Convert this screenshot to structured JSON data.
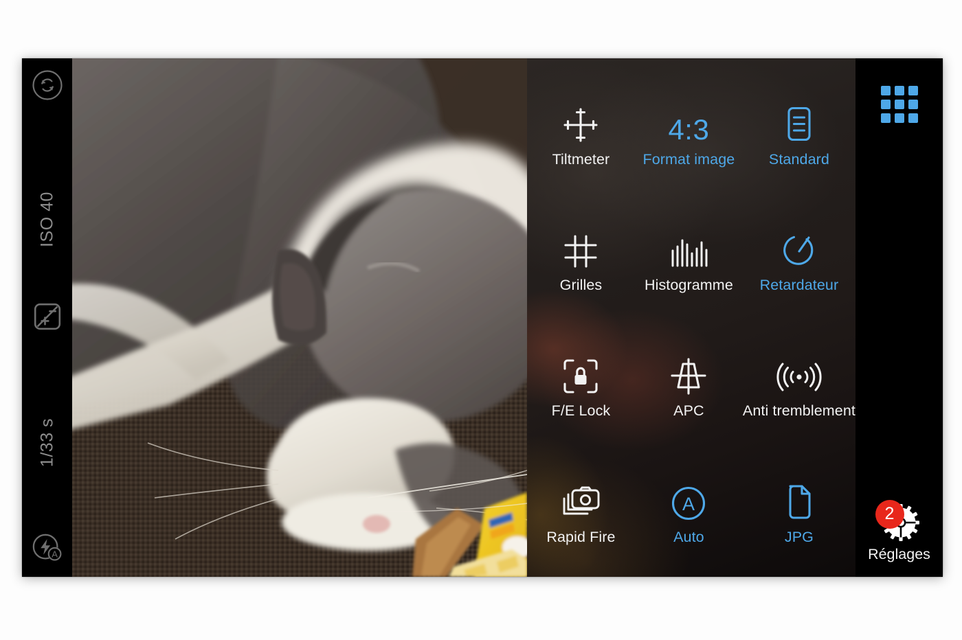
{
  "left_rail": {
    "flip_camera_icon": "camera-flip-icon",
    "iso_readout": "ISO 40",
    "exposure_compensation_icon": "exposure-compensation-icon",
    "shutter_readout": "1/33 s",
    "flash_icon": "flash-auto-icon"
  },
  "viewfinder": {
    "subject": "sleeping grey and white cat on brown couch next to yellow book"
  },
  "options": [
    {
      "icon": "tiltmeter-crosshair-icon",
      "label": "Tiltmeter",
      "state": "off",
      "name": "tiltmeter"
    },
    {
      "icon": "aspect-ratio-text",
      "label": "Format image",
      "state": "on",
      "name": "format-image",
      "value": "4:3"
    },
    {
      "icon": "document-lines-icon",
      "label": "Standard",
      "state": "on",
      "name": "standard"
    },
    {
      "icon": "grid-hash-icon",
      "label": "Grilles",
      "state": "off",
      "name": "grilles"
    },
    {
      "icon": "histogram-bars-icon",
      "label": "Histogramme",
      "state": "off",
      "name": "histogramme"
    },
    {
      "icon": "timer-icon",
      "label": "Retardateur",
      "state": "on",
      "name": "retardateur"
    },
    {
      "icon": "lock-focus-icon",
      "label": "F/E Lock",
      "state": "off",
      "name": "fe-lock"
    },
    {
      "icon": "perspective-correct-icon",
      "label": "APC",
      "state": "off",
      "name": "apc"
    },
    {
      "icon": "stabilization-waves-icon",
      "label": "Anti tremblement",
      "state": "off",
      "name": "anti-tremblement"
    },
    {
      "icon": "burst-camera-icon",
      "label": "Rapid Fire",
      "state": "off",
      "name": "rapid-fire"
    },
    {
      "icon": "auto-circle-a-icon",
      "label": "Auto",
      "state": "on",
      "name": "auto"
    },
    {
      "icon": "file-page-icon",
      "label": "JPG",
      "state": "on",
      "name": "jpg"
    }
  ],
  "right_rail": {
    "apps_grid_icon": "apps-grid-icon",
    "settings_label": "Réglages",
    "settings_badge": "2",
    "settings_icon": "gear-icon"
  },
  "colors": {
    "accent_blue": "#4ea8e8",
    "badge_red": "#e8271b",
    "label_white": "#f2f2f2",
    "rail_grey": "#8d8d8d"
  }
}
